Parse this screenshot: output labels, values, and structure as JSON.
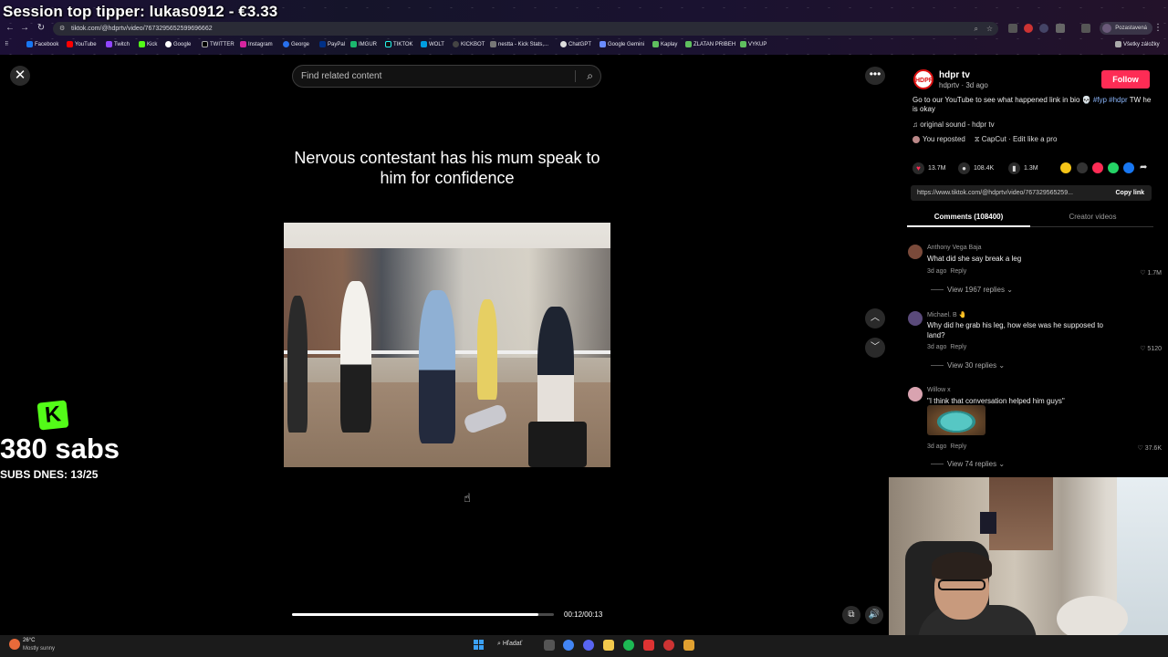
{
  "stream": {
    "top_tipper": "Session top tipper: lukas0912 - €3.33",
    "subs_count": "380 sabs",
    "subs_today": "SUBS DNES: 13/25"
  },
  "browser": {
    "url": "tiktok.com/@hdprtv/video/7673295652599696662",
    "profile_label": "Pozastavená",
    "bookmarks": [
      "Facebook",
      "YouTube",
      "Twitch",
      "Kick",
      "Google",
      "TWITTER",
      "Instagram",
      "George",
      "PayPal",
      "IMGUR",
      "TIKTOK",
      "WOLT",
      "KICKBOT",
      "nestta - Kick Stats,...",
      "ChatGPT",
      "Google Gemini",
      "Kaplay",
      "ZLATAN PRIBEH",
      "VYKUP"
    ],
    "all_bookmarks": "Všetky záložky"
  },
  "search": {
    "placeholder": "Find related content"
  },
  "video": {
    "caption": "Nervous contestant has his mum speak to him for confidence",
    "time": "00:12/00:13",
    "progress": 0.94
  },
  "post": {
    "author_name": "hdpr tv",
    "author_meta": "hdprtv · 3d ago",
    "follow_label": "Follow",
    "description": "Go to our YouTube to see what happened link in bio 💀",
    "hashtags": "#fyp #hdpr",
    "description_tail": "TW he is okay",
    "sound": "original sound - hdpr tv",
    "reposted": "You reposted",
    "capcut": "CapCut · Edit like a pro",
    "likes": "13.7M",
    "comments": "108.4K",
    "saves": "1.3M",
    "link": "https://www.tiktok.com/@hdprtv/video/767329565259...",
    "copy_link": "Copy link",
    "tab_comments": "Comments (108400)",
    "tab_creator": "Creator videos"
  },
  "comments": [
    {
      "name": "Anthony Vega Baja",
      "text": "What did she say break a leg",
      "time": "3d ago",
      "reply": "Reply",
      "likes": "1.7M",
      "replies": "View 1967 replies",
      "avatar_color": "#7a4a3a"
    },
    {
      "name": "Michael. B 🤚",
      "text": "Why did he grab his leg, how else was he supposed to land?",
      "time": "3d ago",
      "reply": "Reply",
      "likes": "5120",
      "replies": "View 30 replies",
      "avatar_color": "#5a4a7a"
    },
    {
      "name": "Willow x",
      "text": "\"I think that conversation helped him guys\"",
      "time": "3d ago",
      "reply": "Reply",
      "likes": "37.6K",
      "replies": "View 74 replies",
      "avatar_color": "#d9a3b0"
    }
  ],
  "taskbar": {
    "temperature": "26°C",
    "weather": "Mostly sunny",
    "search_label": "Hľadať"
  },
  "colors": {
    "follow": "#fe2c55",
    "kick_green": "#53fc18"
  }
}
